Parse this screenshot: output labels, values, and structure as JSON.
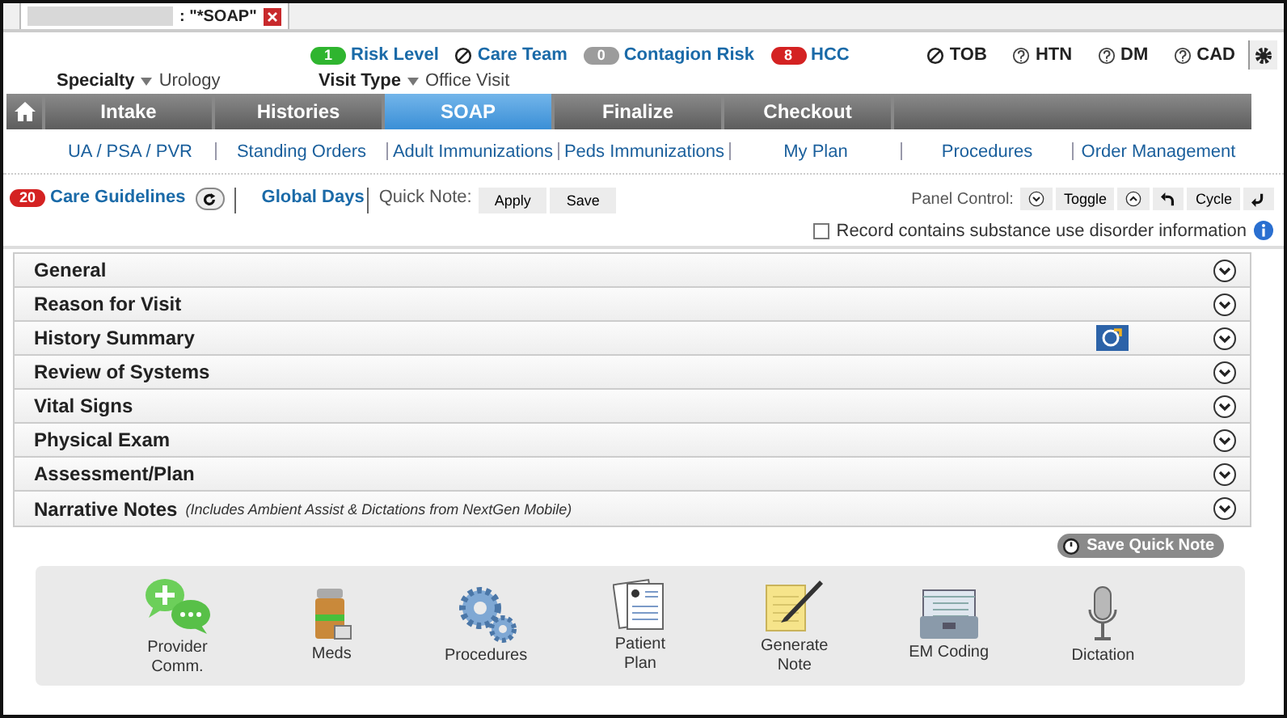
{
  "doc_tab": {
    "title": ": \"*SOAP\""
  },
  "flags": [
    {
      "kind": "badge",
      "count": "1",
      "label": "Risk Level",
      "color": "#2fb52f"
    },
    {
      "kind": "blocked",
      "label": "Care Team"
    },
    {
      "kind": "badge",
      "count": "0",
      "label": "Contagion Risk",
      "color": "#9c9c9c"
    },
    {
      "kind": "badge",
      "count": "8",
      "label": "HCC",
      "color": "#d42222"
    }
  ],
  "conditions": [
    {
      "kind": "blocked",
      "label": "TOB"
    },
    {
      "kind": "unknown",
      "label": "HTN"
    },
    {
      "kind": "unknown",
      "label": "DM"
    },
    {
      "kind": "unknown",
      "label": "CAD"
    }
  ],
  "specialty": {
    "label": "Specialty",
    "value": "Urology"
  },
  "visit_type": {
    "label": "Visit Type",
    "value": "Office Visit"
  },
  "nav_tabs": [
    {
      "label": "Intake",
      "selected": false
    },
    {
      "label": "Histories",
      "selected": false
    },
    {
      "label": "SOAP",
      "selected": true
    },
    {
      "label": "Finalize",
      "selected": false
    },
    {
      "label": "Checkout",
      "selected": false
    }
  ],
  "sub_nav": [
    "UA / PSA / PVR",
    "Standing Orders",
    "Adult Immunizations",
    "Peds Immunizations",
    "My Plan",
    "Procedures",
    "Order Management"
  ],
  "care_guidelines": {
    "count": "20",
    "label": "Care Guidelines"
  },
  "global_days": "Global Days",
  "quick_note": {
    "label": "Quick Note:",
    "buttons": [
      "Apply",
      "Save"
    ]
  },
  "panel_control": {
    "label": "Panel Control:",
    "toggle": "Toggle",
    "cycle": "Cycle"
  },
  "substance_use": {
    "checked": false,
    "label": "Record contains substance use disorder information"
  },
  "panels": [
    {
      "title": "General",
      "expanded": false
    },
    {
      "title": "Reason for Visit",
      "expanded": false
    },
    {
      "title": "History Summary",
      "expanded": false,
      "has_import": true
    },
    {
      "title": "Review of Systems",
      "expanded": false
    },
    {
      "title": "Vital Signs",
      "expanded": false
    },
    {
      "title": "Physical Exam",
      "expanded": false
    },
    {
      "title": "Assessment/Plan",
      "expanded": false
    },
    {
      "title": "Narrative Notes",
      "expanded": false,
      "note": "(Includes Ambient Assist & Dictations from NextGen Mobile)"
    }
  ],
  "save_quick_note": "Save Quick Note",
  "toolbar": [
    {
      "kind": "chat",
      "label": "Provider\nComm."
    },
    {
      "kind": "meds",
      "label": "Meds"
    },
    {
      "kind": "gears",
      "label": "Procedures"
    },
    {
      "kind": "plan",
      "label": "Patient\nPlan"
    },
    {
      "kind": "note",
      "label": "Generate\nNote"
    },
    {
      "kind": "coding",
      "label": "EM Coding"
    },
    {
      "kind": "mic",
      "label": "Dictation"
    }
  ]
}
